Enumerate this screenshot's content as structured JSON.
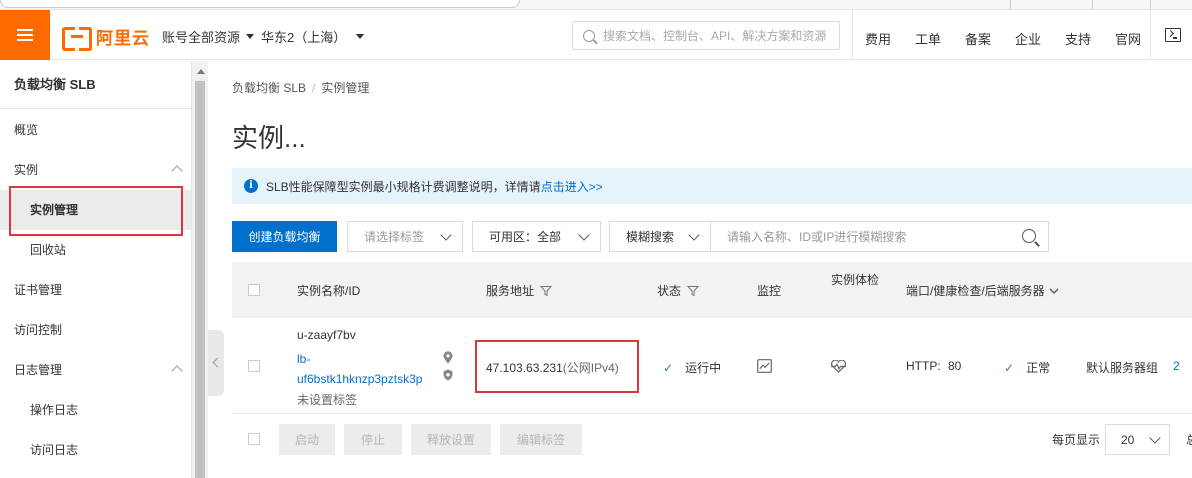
{
  "header": {
    "logo_text": "阿里云",
    "account_label": "账号全部资源",
    "region_label": "华东2（上海）",
    "search_placeholder": "搜索文档、控制台、API、解决方案和资源",
    "nav": [
      "费用",
      "工单",
      "备案",
      "企业",
      "支持",
      "官网"
    ]
  },
  "sidebar": {
    "title": "负载均衡 SLB",
    "items": [
      {
        "label": "概览"
      },
      {
        "label": "实例"
      },
      {
        "label": "实例管理"
      },
      {
        "label": "回收站"
      },
      {
        "label": "证书管理"
      },
      {
        "label": "访问控制"
      },
      {
        "label": "日志管理"
      },
      {
        "label": "操作日志"
      },
      {
        "label": "访问日志"
      }
    ]
  },
  "breadcrumb": {
    "root": "负载均衡 SLB",
    "sep": "/",
    "current": "实例管理"
  },
  "page_title": "实例...",
  "notice": {
    "text": "SLB性能保障型实例最小规格计费调整说明，详情请",
    "link": "点击进入>>",
    "icon": "i"
  },
  "toolbar": {
    "create_label": "创建负载均衡",
    "tag_placeholder": "请选择标签",
    "zone_label": "可用区：",
    "zone_value": "全部",
    "search_mode": "模糊搜索",
    "search_placeholder": "请输入名称、ID或IP进行模糊搜索"
  },
  "table": {
    "headers": [
      "实例名称/ID",
      "服务地址",
      "状态",
      "监控",
      "实例体检",
      "端口/健康检查/后端服务器"
    ],
    "rows": [
      {
        "name": "u-zaayf7bv",
        "id_line1": "lb-",
        "id_line2": "uf6bstk1hknzp3pztsk3p",
        "tag": "未设置标签",
        "address": "47.103.63.231",
        "address_type": "(公网IPv4)",
        "status": "运行中",
        "protocol": "HTTP:",
        "port": "80",
        "health": "正常",
        "server_group": "默认服务器组",
        "server_count": "2"
      }
    ]
  },
  "bottom": {
    "buttons": [
      "启动",
      "停止",
      "释放设置",
      "编辑标签"
    ],
    "per_page_label": "每页显示",
    "per_page_value": "20",
    "trailing": "总"
  },
  "colors": {
    "brand": "#ff6a00",
    "primary": "#0070cc",
    "highlight": "#d9363e",
    "success": "#2a9d2a"
  }
}
